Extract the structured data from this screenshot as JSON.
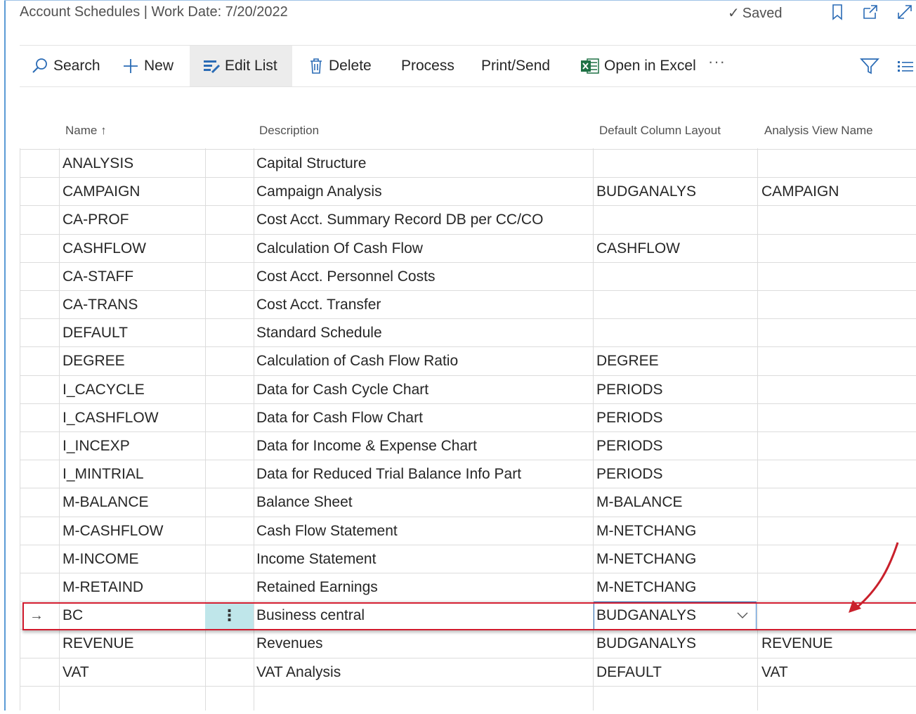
{
  "header": {
    "title": "Account Schedules | Work Date: 7/20/2022",
    "saved_label": "Saved"
  },
  "actions": {
    "search": "Search",
    "new": "New",
    "edit_list": "Edit List",
    "delete": "Delete",
    "process": "Process",
    "print_send": "Print/Send",
    "open_in_excel": "Open in Excel",
    "more": "···"
  },
  "columns": {
    "name": "Name ↑",
    "description": "Description",
    "default_column_layout": "Default Column Layout",
    "analysis_view_name": "Analysis View Name"
  },
  "rows": [
    {
      "name": "ANALYSIS",
      "description": "Capital Structure",
      "layout": "",
      "view": ""
    },
    {
      "name": "CAMPAIGN",
      "description": "Campaign Analysis",
      "layout": "BUDGANALYS",
      "view": "CAMPAIGN"
    },
    {
      "name": "CA-PROF",
      "description": "Cost Acct. Summary Record DB per CC/CO",
      "layout": "",
      "view": ""
    },
    {
      "name": "CASHFLOW",
      "description": "Calculation Of Cash Flow",
      "layout": "CASHFLOW",
      "view": ""
    },
    {
      "name": "CA-STAFF",
      "description": "Cost Acct. Personnel Costs",
      "layout": "",
      "view": ""
    },
    {
      "name": "CA-TRANS",
      "description": "Cost Acct. Transfer",
      "layout": "",
      "view": ""
    },
    {
      "name": "DEFAULT",
      "description": "Standard Schedule",
      "layout": "",
      "view": ""
    },
    {
      "name": "DEGREE",
      "description": "Calculation of Cash Flow Ratio",
      "layout": "DEGREE",
      "view": ""
    },
    {
      "name": "I_CACYCLE",
      "description": "Data for Cash Cycle Chart",
      "layout": "PERIODS",
      "view": ""
    },
    {
      "name": "I_CASHFLOW",
      "description": "Data for Cash Flow Chart",
      "layout": "PERIODS",
      "view": ""
    },
    {
      "name": "I_INCEXP",
      "description": "Data for Income & Expense Chart",
      "layout": "PERIODS",
      "view": ""
    },
    {
      "name": "I_MINTRIAL",
      "description": "Data for Reduced Trial Balance Info Part",
      "layout": "PERIODS",
      "view": ""
    },
    {
      "name": "M-BALANCE",
      "description": "Balance Sheet",
      "layout": "M-BALANCE",
      "view": ""
    },
    {
      "name": "M-CASHFLOW",
      "description": "Cash Flow Statement",
      "layout": "M-NETCHANG",
      "view": ""
    },
    {
      "name": "M-INCOME",
      "description": "Income Statement",
      "layout": "M-NETCHANG",
      "view": ""
    },
    {
      "name": "M-RETAIND",
      "description": "Retained Earnings",
      "layout": "M-NETCHANG",
      "view": ""
    },
    {
      "name": "BC",
      "description": "Business central",
      "layout": "BUDGANALYS",
      "view": "",
      "selected": true
    },
    {
      "name": "REVENUE",
      "description": "Revenues",
      "layout": "BUDGANALYS",
      "view": "REVENUE"
    },
    {
      "name": "VAT",
      "description": "VAT Analysis",
      "layout": "DEFAULT",
      "view": "VAT"
    },
    {
      "name": "",
      "description": "",
      "layout": "",
      "view": ""
    }
  ],
  "selected_row_marker": "→",
  "row_menu_glyph": "⋮",
  "colors": {
    "accent": "#3a7dc6",
    "highlight": "#d11b2e",
    "selected_cell": "#bfe6ea"
  }
}
